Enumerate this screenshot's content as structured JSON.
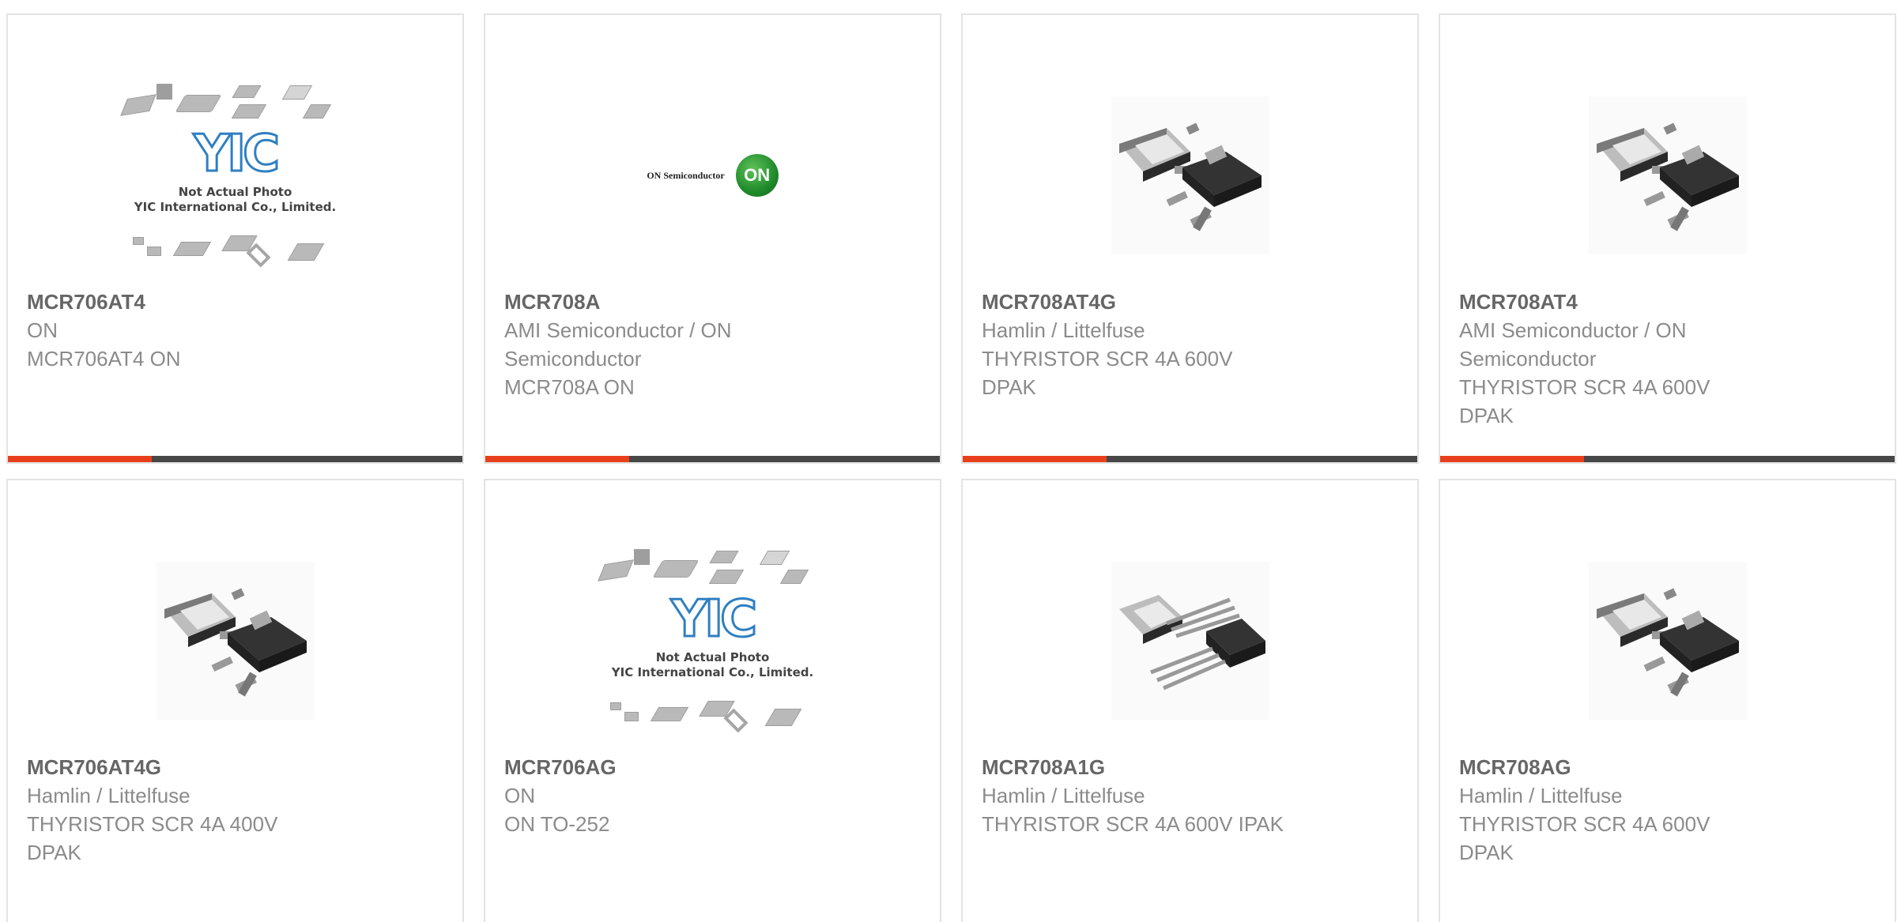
{
  "accent_color": "#e8401c",
  "bar_color": "#474747",
  "products": [
    {
      "part": "MCR706AT4",
      "manufacturer": "ON",
      "description": "MCR706AT4 ON",
      "image": "placeholder-photo-icon",
      "note1": "Not Actual Photo",
      "note2": "YIC International Co., Limited.",
      "logo": "YIC"
    },
    {
      "part": "MCR708A",
      "manufacturer": "AMI Semiconductor / ON Semiconductor",
      "description": "MCR708A ON",
      "image": "on-semiconductor-logo",
      "logo_text": "ON Semiconductor",
      "logo_mark": "ON"
    },
    {
      "part": "MCR708AT4G",
      "manufacturer": "Hamlin / Littelfuse",
      "description": "THYRISTOR SCR 4A 600V DPAK",
      "image": "dpak-package-icon"
    },
    {
      "part": "MCR708AT4",
      "manufacturer": "AMI Semiconductor / ON Semiconductor",
      "description": "THYRISTOR SCR 4A 600V DPAK",
      "image": "dpak-package-icon"
    },
    {
      "part": "MCR706AT4G",
      "manufacturer": "Hamlin / Littelfuse",
      "description": "THYRISTOR SCR 4A 400V DPAK",
      "image": "dpak-package-icon"
    },
    {
      "part": "MCR706AG",
      "manufacturer": "ON",
      "description": "ON TO-252",
      "image": "placeholder-photo-icon",
      "note1": "Not Actual Photo",
      "note2": "YIC International Co., Limited.",
      "logo": "YIC"
    },
    {
      "part": "MCR708A1G",
      "manufacturer": "Hamlin / Littelfuse",
      "description": "THYRISTOR SCR 4A 600V IPAK",
      "image": "ipak-package-icon"
    },
    {
      "part": "MCR708AG",
      "manufacturer": "Hamlin / Littelfuse",
      "description": "THYRISTOR SCR 4A 600V DPAK",
      "image": "dpak-package-icon"
    }
  ]
}
